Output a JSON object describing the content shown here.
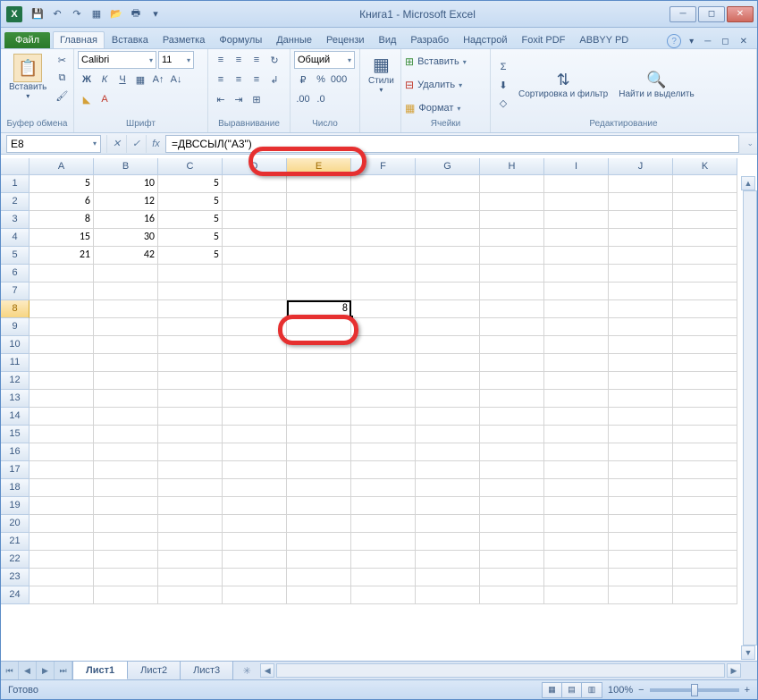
{
  "window": {
    "title": "Книга1 - Microsoft Excel"
  },
  "tabs": {
    "file": "Файл",
    "items": [
      "Главная",
      "Вставка",
      "Разметка",
      "Формулы",
      "Данные",
      "Рецензи",
      "Вид",
      "Разрабо",
      "Надстрой",
      "Foxit PDF",
      "ABBYY PD"
    ],
    "active_index": 0
  },
  "ribbon": {
    "clipboard": {
      "paste": "Вставить",
      "label": "Буфер обмена"
    },
    "font": {
      "name": "Calibri",
      "size": "11",
      "label": "Шрифт"
    },
    "alignment": {
      "label": "Выравнивание"
    },
    "number": {
      "format": "Общий",
      "label": "Число"
    },
    "styles": {
      "btn": "Стили",
      "label": ""
    },
    "cells": {
      "insert": "Вставить",
      "delete": "Удалить",
      "format": "Формат",
      "label": "Ячейки"
    },
    "editing": {
      "sort": "Сортировка и фильтр",
      "find": "Найти и выделить",
      "label": "Редактирование"
    }
  },
  "formula": {
    "name_box": "E8",
    "formula": "=ДВССЫЛ(\"A3\")"
  },
  "grid": {
    "columns": [
      "A",
      "B",
      "C",
      "D",
      "E",
      "F",
      "G",
      "H",
      "I",
      "J",
      "K"
    ],
    "active_col_index": 4,
    "row_count": 24,
    "active_row": 8,
    "cells": {
      "A1": "5",
      "B1": "10",
      "C1": "5",
      "A2": "6",
      "B2": "12",
      "C2": "5",
      "A3": "8",
      "B3": "16",
      "C3": "5",
      "A4": "15",
      "B4": "30",
      "C4": "5",
      "A5": "21",
      "B5": "42",
      "C5": "5",
      "E8": "8"
    },
    "active_cell": "E8"
  },
  "sheets": {
    "items": [
      "Лист1",
      "Лист2",
      "Лист3"
    ],
    "active_index": 0
  },
  "status": {
    "text": "Готово",
    "zoom": "100%"
  }
}
